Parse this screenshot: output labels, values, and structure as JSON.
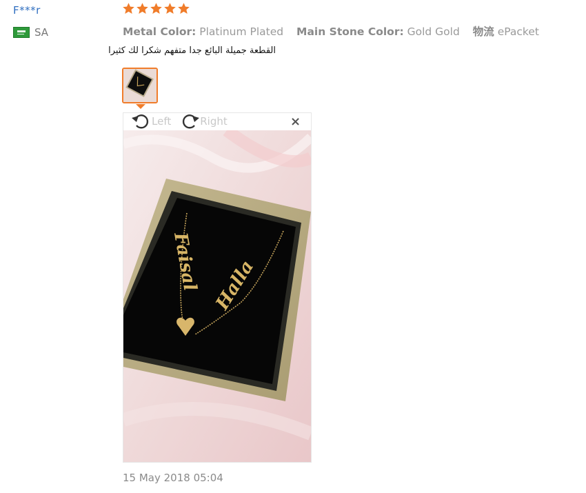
{
  "reviewer": {
    "name": "F***r",
    "country_code": "SA",
    "flag_icon": "saudi-flag-icon"
  },
  "rating": {
    "stars": 5,
    "max": 5,
    "color": "#f07c2a"
  },
  "attributes": [
    {
      "label": "Metal Color:",
      "value": "Platinum Plated"
    },
    {
      "label": "Main Stone Color:",
      "value": "Gold Gold"
    },
    {
      "label": "物流",
      "value": "ePacket"
    }
  ],
  "review": {
    "text": "القطعة جميلة البائع جدا متفهم شكرا لك كثيرا"
  },
  "viewer": {
    "rotate_left_label": "Left",
    "rotate_right_label": "Right",
    "close_glyph": "×"
  },
  "photo": {
    "pendant_left_text": "Faisal",
    "pendant_right_text": "Halla"
  },
  "timestamp": "15 May 2018 05:04",
  "colors": {
    "accent": "#f07c2a",
    "link": "#2f6ec0"
  }
}
